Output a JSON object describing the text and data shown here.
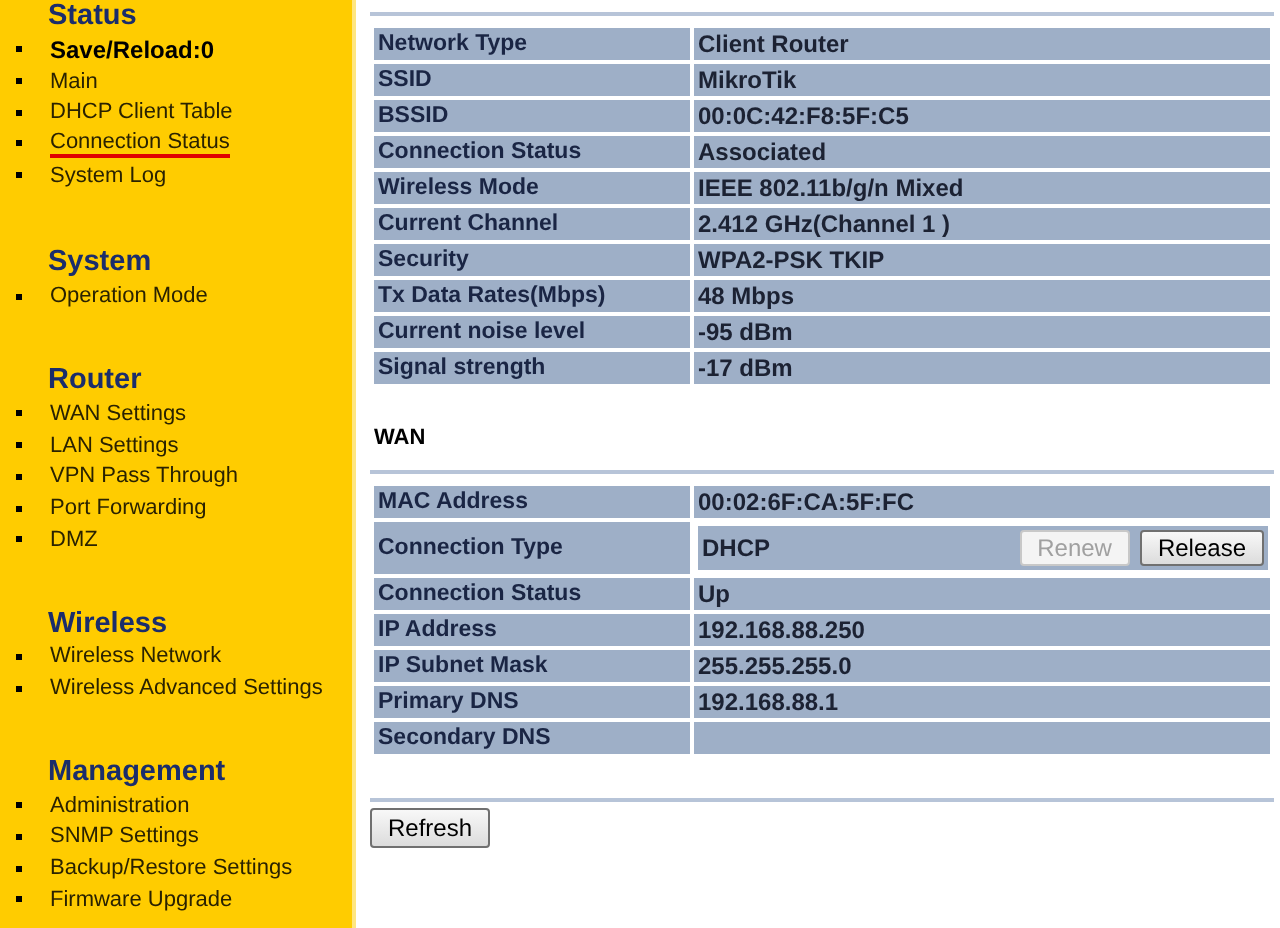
{
  "sidebar": {
    "groups": [
      {
        "heading": "Status",
        "items": [
          {
            "label": "Save/Reload:0",
            "kind": "status",
            "selected": false
          },
          {
            "label": "Main",
            "kind": "link",
            "selected": false
          },
          {
            "label": "DHCP Client Table",
            "kind": "link",
            "selected": false
          },
          {
            "label": "Connection Status",
            "kind": "link",
            "selected": true
          },
          {
            "label": "System Log",
            "kind": "link",
            "selected": false
          }
        ]
      },
      {
        "heading": "System",
        "items": [
          {
            "label": "Operation Mode",
            "kind": "link",
            "selected": false
          }
        ]
      },
      {
        "heading": "Router",
        "items": [
          {
            "label": "WAN Settings",
            "kind": "link",
            "selected": false
          },
          {
            "label": "LAN Settings",
            "kind": "link",
            "selected": false
          },
          {
            "label": "VPN Pass Through",
            "kind": "link",
            "selected": false
          },
          {
            "label": "Port Forwarding",
            "kind": "link",
            "selected": false
          },
          {
            "label": "DMZ",
            "kind": "link",
            "selected": false
          }
        ]
      },
      {
        "heading": "Wireless",
        "items": [
          {
            "label": "Wireless Network",
            "kind": "link",
            "selected": false
          },
          {
            "label": "Wireless Advanced Settings",
            "kind": "link",
            "selected": false
          }
        ]
      },
      {
        "heading": "Management",
        "items": [
          {
            "label": "Administration",
            "kind": "link",
            "selected": false
          },
          {
            "label": "SNMP Settings",
            "kind": "link",
            "selected": false
          },
          {
            "label": "Backup/Restore Settings",
            "kind": "link",
            "selected": false
          },
          {
            "label": "Firmware Upgrade",
            "kind": "link",
            "selected": false
          }
        ]
      }
    ]
  },
  "wireless_table": {
    "rows": [
      {
        "label": "Network Type",
        "value": "Client Router"
      },
      {
        "label": "SSID",
        "value": "MikroTik"
      },
      {
        "label": "BSSID",
        "value": "00:0C:42:F8:5F:C5"
      },
      {
        "label": "Connection Status",
        "value": "Associated"
      },
      {
        "label": "Wireless Mode",
        "value": "IEEE 802.11b/g/n Mixed"
      },
      {
        "label": "Current Channel",
        "value": "2.412 GHz(Channel 1 )"
      },
      {
        "label": "Security",
        "value": "WPA2-PSK TKIP"
      },
      {
        "label": "Tx Data Rates(Mbps)",
        "value": "48 Mbps"
      },
      {
        "label": "Current noise level",
        "value": "-95 dBm"
      },
      {
        "label": "Signal strength",
        "value": "-17 dBm"
      }
    ]
  },
  "wan": {
    "heading": "WAN",
    "rows": [
      {
        "label": "MAC Address",
        "value": "00:02:6F:CA:5F:FC"
      },
      {
        "label": "Connection Type",
        "value": "DHCP",
        "buttons": [
          {
            "label": "Renew",
            "disabled": true
          },
          {
            "label": "Release",
            "disabled": false
          }
        ]
      },
      {
        "label": "Connection Status",
        "value": "Up"
      },
      {
        "label": "IP Address",
        "value": "192.168.88.250"
      },
      {
        "label": "IP Subnet Mask",
        "value": "255.255.255.0"
      },
      {
        "label": "Primary DNS",
        "value": "192.168.88.1"
      },
      {
        "label": "Secondary DNS",
        "value": ""
      }
    ]
  },
  "refresh_button": {
    "label": "Refresh"
  }
}
